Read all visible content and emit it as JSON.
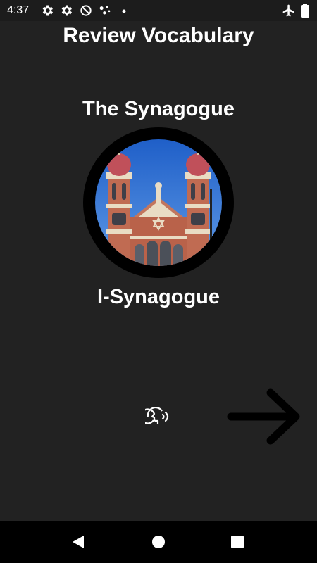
{
  "status": {
    "time": "4:37",
    "icons": [
      "gear-icon",
      "gear-icon",
      "data-saver-icon",
      "assistant-dots-icon",
      "notification-dot-icon",
      "airplane-mode-icon",
      "battery-full-icon"
    ]
  },
  "header": {
    "title": "Review Vocabulary"
  },
  "card": {
    "english_word": "The Synagogue",
    "translated_word": "I-Synagogue",
    "image_subject": "synagogue-building"
  },
  "controls": {
    "speak_icon": "speak-icon",
    "next_icon": "arrow-right-icon"
  },
  "nav": {
    "buttons": [
      "back-icon",
      "home-icon",
      "recents-icon"
    ]
  },
  "colors": {
    "background": "#222222",
    "text": "#ffffff",
    "ring": "#000000",
    "nav_bar": "#000000"
  }
}
